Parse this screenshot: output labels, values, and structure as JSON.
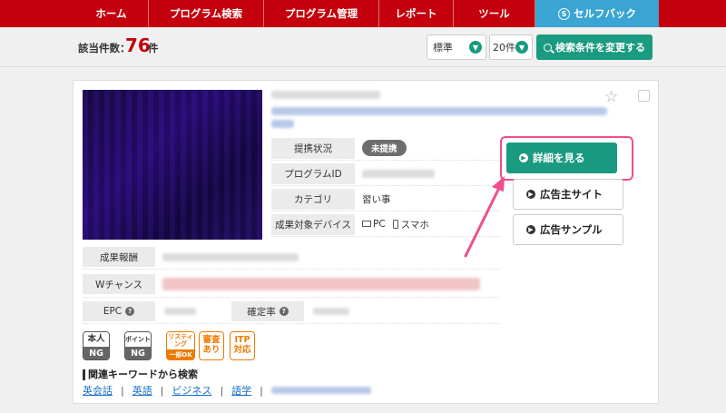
{
  "nav": {
    "items": [
      "ホーム",
      "プログラム検索",
      "プログラム管理",
      "レポート",
      "ツール"
    ],
    "selfback": "セルフバック",
    "selfback_icon": "S"
  },
  "count": {
    "label": "該当件数：",
    "value": "76",
    "unit": "件"
  },
  "controls": {
    "sort": "標準",
    "per_page": "20件",
    "change_button": "検索条件を変更する"
  },
  "program": {
    "rows": [
      {
        "label": "提携状況",
        "value": "未提携"
      },
      {
        "label": "プログラムID",
        "value": ""
      },
      {
        "label": "カテゴリ",
        "value": "習い事"
      },
      {
        "label": "成果対象デバイス",
        "pc": "PC",
        "sp": "スマホ"
      }
    ],
    "buttons": {
      "detail": "詳細を見る",
      "advertiser": "広告主サイト",
      "sample": "広告サンプル"
    },
    "stats": {
      "reward": "成果報酬",
      "wchance": "Wチャンス",
      "epc": "EPC",
      "confirm_rate": "確定率"
    }
  },
  "tags": {
    "honnin_top": "本人",
    "honnin_bottom": "NG",
    "point_top": "ポイント",
    "point_bottom": "NG",
    "listing_top": "リスティング",
    "listing_bottom": "一部OK",
    "review_line1": "審査",
    "review_line2": "あり",
    "itp_line1": "ITP",
    "itp_line2": "対応"
  },
  "keywords": {
    "title": "関連キーワードから検索",
    "links": [
      "英会話",
      "英語",
      "ビジネス",
      "語学"
    ]
  },
  "icons": {
    "star": "star-icon",
    "search": "search-icon",
    "arrow": "arrow-right-icon"
  },
  "colors": {
    "brand_red": "#c4000d",
    "active_tab": "#3aa5d2",
    "teal": "#1a9a80",
    "highlight_pink": "#f04e8c",
    "orange": "#ee7a00"
  }
}
